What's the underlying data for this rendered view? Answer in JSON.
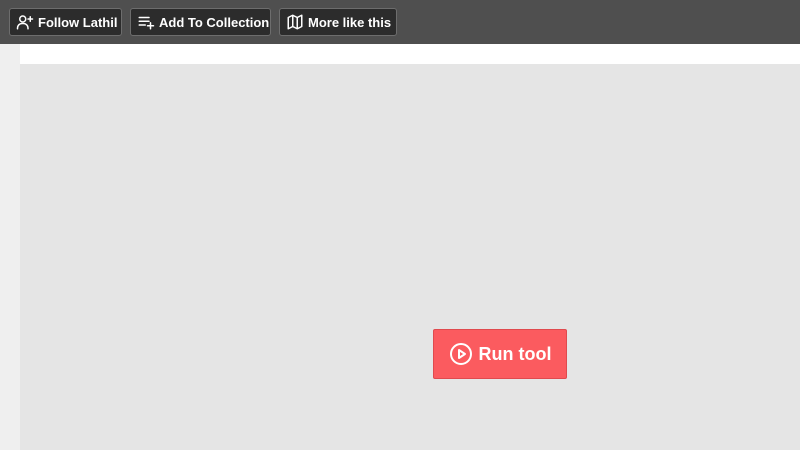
{
  "toolbar": {
    "follow_label": "Follow Lathil",
    "collection_label": "Add To Collection",
    "more_label": "More like this",
    "icons": [
      "user-plus-icon",
      "playlist-add-icon",
      "map-icon"
    ]
  },
  "main": {
    "run_label": "Run tool",
    "run_icon": "play-circle-icon"
  },
  "colors": {
    "toolbar_bg": "#4f4f4f",
    "button_bg": "#2c2c2c",
    "canvas_bg": "#e5e5e5",
    "run_button": "#fb5b5f"
  }
}
